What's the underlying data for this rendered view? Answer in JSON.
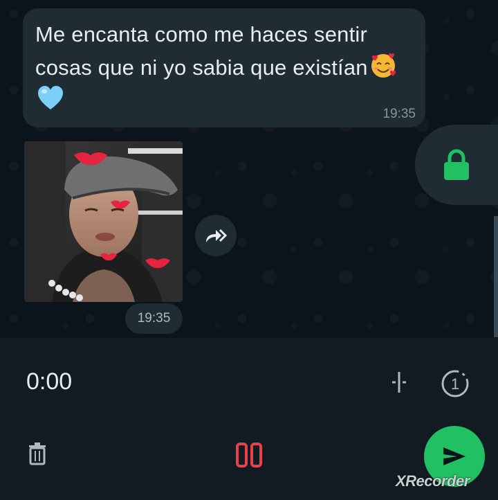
{
  "messages": {
    "text_message": {
      "text": "Me encanta como me haces sentir cosas que ni yo sabia que existían",
      "emojis": [
        "smiling-face-with-hearts",
        "light-blue-heart"
      ],
      "time": "19:35"
    },
    "image_message": {
      "time": "19:35"
    }
  },
  "recorder": {
    "elapsed": "0:00",
    "timer_badge": "1"
  },
  "watermark": "XRecorder",
  "colors": {
    "background": "#0b141a",
    "bubble": "#202c33",
    "panel": "#111b21",
    "accent": "#21c063",
    "pause": "#e8414e"
  },
  "icons": [
    "forward-icon",
    "lock-icon",
    "waveform-icon",
    "timer-icon",
    "delete-icon",
    "pause-icon",
    "send-icon"
  ]
}
